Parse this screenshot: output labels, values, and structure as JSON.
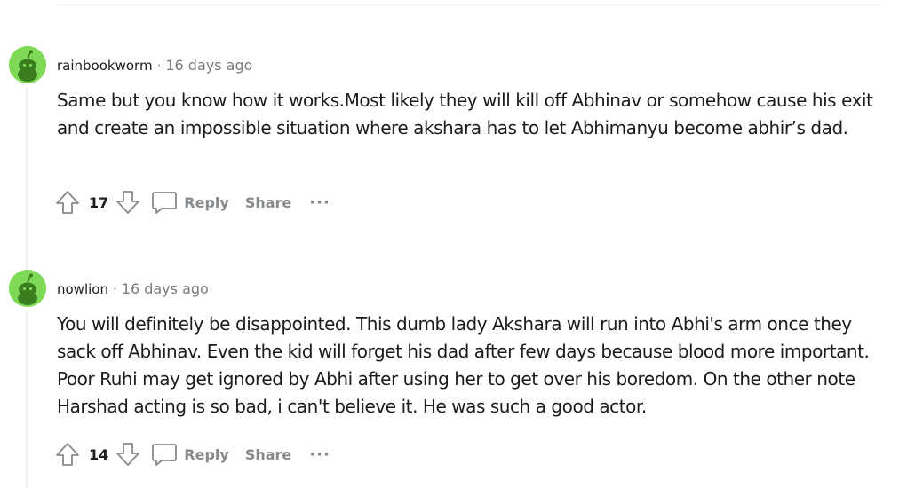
{
  "comments": [
    {
      "username": "rainbookworm",
      "separator": "·",
      "timestamp": "16 days ago",
      "body": "Same but you know how it works.Most likely they will kill off Abhinav or somehow cause his exit and create an impossible situation where akshara has to let Abhimanyu become abhir’s dad.",
      "votes": "17",
      "reply_label": "Reply",
      "share_label": "Share",
      "more_label": "···"
    },
    {
      "username": "nowlion",
      "separator": "·",
      "timestamp": "16 days ago",
      "body": "You will definitely be disappointed. This dumb lady Akshara will run into Abhi's arm once they sack off Abhinav. Even the kid will forget his dad after few days because blood more important. Poor Ruhi may get ignored by Abhi after using her to get over his boredom. On the other note Harshad acting is so bad, i can't believe it. He was such a good actor.",
      "votes": "14",
      "reply_label": "Reply",
      "share_label": "Share",
      "more_label": "···"
    }
  ],
  "icons": {
    "avatar": "snoo-avatar-icon",
    "upvote": "upvote-arrow-icon",
    "downvote": "downvote-arrow-icon",
    "reply": "speech-bubble-icon",
    "more": "ellipsis-icon"
  },
  "colors": {
    "avatar_bg": "#7ed957",
    "muted": "#878a8c",
    "text": "#1c1c1c"
  }
}
